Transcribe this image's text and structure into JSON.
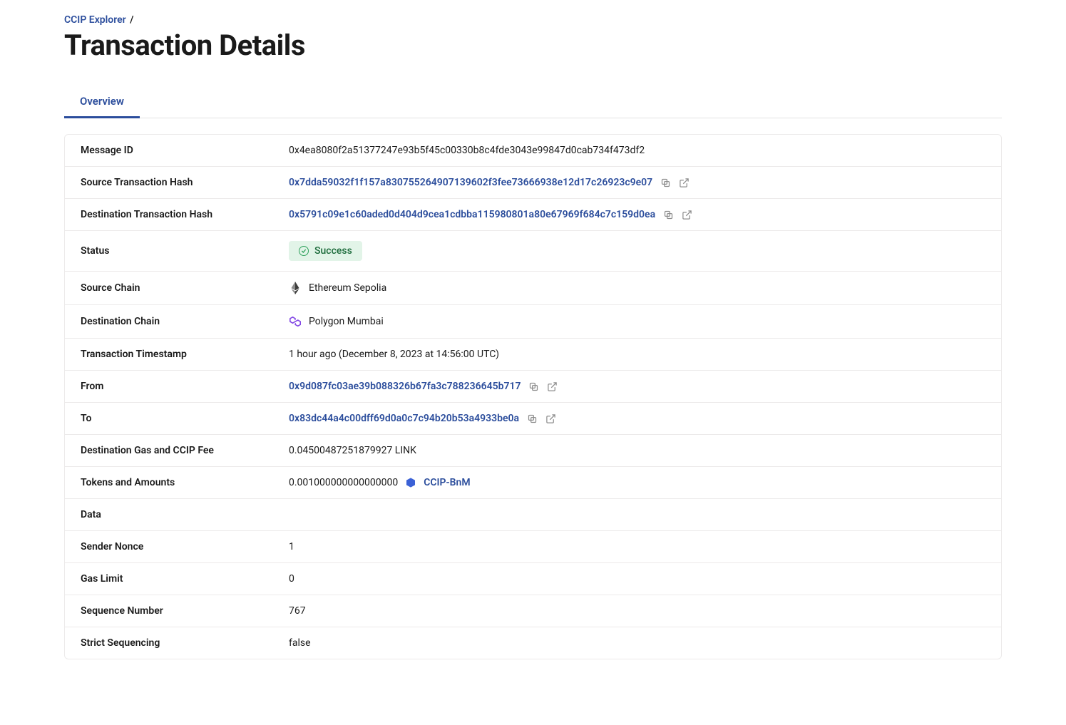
{
  "breadcrumb": {
    "root": "CCIP Explorer",
    "sep": "/"
  },
  "page_title": "Transaction Details",
  "tabs": [
    {
      "label": "Overview",
      "active": true
    }
  ],
  "labels": {
    "message_id": "Message ID",
    "source_tx_hash": "Source Transaction Hash",
    "dest_tx_hash": "Destination Transaction Hash",
    "status": "Status",
    "source_chain": "Source Chain",
    "dest_chain": "Destination Chain",
    "timestamp": "Transaction Timestamp",
    "from": "From",
    "to": "To",
    "gas_fee": "Destination Gas and CCIP Fee",
    "tokens": "Tokens and Amounts",
    "data": "Data",
    "sender_nonce": "Sender Nonce",
    "gas_limit": "Gas Limit",
    "sequence_number": "Sequence Number",
    "strict_sequencing": "Strict Sequencing"
  },
  "values": {
    "message_id": "0x4ea8080f2a51377247e93b5f45c00330b8c4fde3043e99847d0cab734f473df2",
    "source_tx_hash": "0x7dda59032f1f157a830755264907139602f3fee73666938e12d17c26923c9e07",
    "dest_tx_hash": "0x5791c09e1c60aded0d404d9cea1cdbba115980801a80e67969f684c7c159d0ea",
    "status": "Success",
    "source_chain": "Ethereum Sepolia",
    "dest_chain": "Polygon Mumbai",
    "timestamp": "1 hour ago (December 8, 2023 at 14:56:00 UTC)",
    "from": "0x9d087fc03ae39b088326b67fa3c788236645b717",
    "to": "0x83dc44a4c00dff69d0a0c7c94b20b53a4933be0a",
    "gas_fee": "0.04500487251879927 LINK",
    "token_amount": "0.001000000000000000",
    "token_name": "CCIP-BnM",
    "data": "",
    "sender_nonce": "1",
    "gas_limit": "0",
    "sequence_number": "767",
    "strict_sequencing": "false"
  }
}
